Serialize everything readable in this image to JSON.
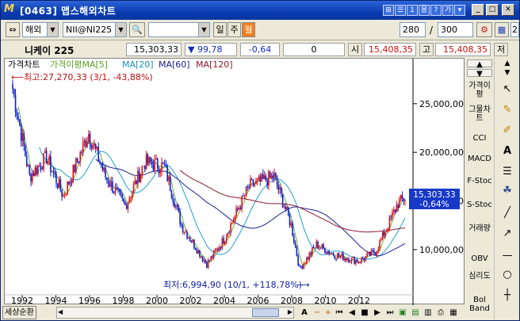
{
  "window": {
    "title": "[0463] 맵스해외차트"
  },
  "title_buttons": [
    "⊞",
    "☰",
    "1",
    "몽",
    "?",
    "가",
    "▾"
  ],
  "toolbar": {
    "market": "해외",
    "symbol": "NII@NI225",
    "period_input": "",
    "period_day": "일",
    "period_week": "주",
    "period_month": "월",
    "count_value": "280",
    "count_sep": "/",
    "count_max": "300",
    "extra_value": "2"
  },
  "infobar": {
    "name": "니케이 225",
    "price": "15,303,33",
    "change": "▼ 99,78",
    "change_rate": "-0,64",
    "volume": "0",
    "open_label": "시",
    "open_value": "15,408,35",
    "high_label": "고",
    "high_value": "15,408,35",
    "low_label": "저"
  },
  "legend": {
    "title": "가격차트",
    "ma5": "가격이평MA[5]",
    "ma20": "MA[20]",
    "ma60": "MA[60]",
    "ma120": "MA[120]"
  },
  "annotations": {
    "high": "최고:27,270,33 (3/1, -43,88%)",
    "low": "최저:6,994,90 (10/1, +118,78%)",
    "current_price": "15,303,33",
    "current_rate": "-0,64%"
  },
  "chart_data": {
    "type": "candlestick",
    "x_ticks": [
      "1992",
      "1994",
      "1996",
      "1998",
      "2000",
      "2002",
      "2004",
      "2006",
      "2008",
      "2010",
      "2012"
    ],
    "y_ticks": [
      "10,000,00",
      "15,000,00",
      "20,000,00",
      "25,000,00"
    ],
    "ylim": [
      6000,
      28000
    ],
    "colors": {
      "up": "#e01010",
      "down": "#1020d0",
      "ma5": "#6ab030",
      "ma20": "#20a0d0",
      "ma60": "#202090",
      "ma120": "#901830"
    }
  },
  "right_panel": [
    "가격이평",
    "그물차트",
    "CCI",
    "MACD",
    "F-Stoc",
    "S-Stoc",
    "거래량",
    "OBV",
    "심리도",
    "Bol Band"
  ],
  "bottom": {
    "label": "세상순환"
  }
}
